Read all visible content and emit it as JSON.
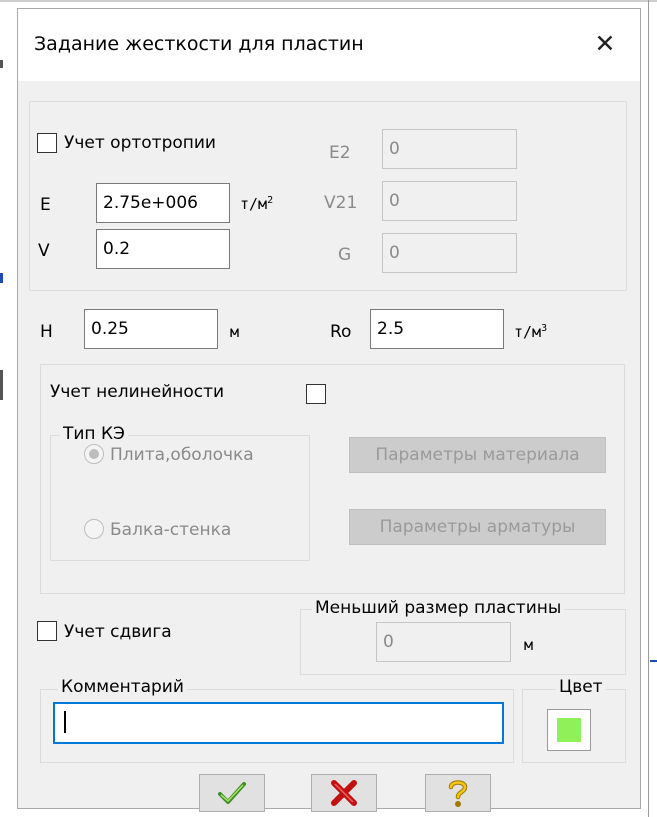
{
  "dialog": {
    "title": "Задание жесткости для пластин",
    "close_glyph": "✕"
  },
  "orthotropy": {
    "checkbox_label": "Учет ортотропии",
    "checked": false,
    "E_label": "E",
    "E_value": "2.75e+006",
    "E_unit": "т/м",
    "E_unit_sup": "2",
    "V_label": "V",
    "V_value": "0.2",
    "E2_label": "E2",
    "E2_value": "0",
    "V21_label": "V21",
    "V21_value": "0",
    "G_label": "G",
    "G_value": "0"
  },
  "thickness": {
    "H_label": "H",
    "H_value": "0.25",
    "H_unit": "м",
    "Ro_label": "Ro",
    "Ro_value": "2.5",
    "Ro_unit": "т/м",
    "Ro_unit_sup": "3"
  },
  "nonlinearity": {
    "label": "Учет нелинейности",
    "checked": false,
    "fe_type_title": "Тип КЭ",
    "options": [
      {
        "label": "Плита,оболочка",
        "selected": true
      },
      {
        "label": "Балка-стенка",
        "selected": false
      }
    ],
    "material_params_button": "Параметры материала",
    "rebar_params_button": "Параметры арматуры"
  },
  "shear": {
    "checkbox_label": "Учет сдвига",
    "checked": false,
    "min_size_title": "Меньший размер пластины",
    "min_size_value": "0",
    "min_size_unit": "м"
  },
  "comment": {
    "title": "Комментарий",
    "value": ""
  },
  "color": {
    "title": "Цвет",
    "swatch_hex": "#8ff05a"
  },
  "buttons": [
    {
      "name": "ok-button",
      "icon": "checkmark-icon"
    },
    {
      "name": "cancel-button",
      "icon": "red-x-icon"
    },
    {
      "name": "help-button",
      "icon": "question-mark-icon"
    }
  ]
}
